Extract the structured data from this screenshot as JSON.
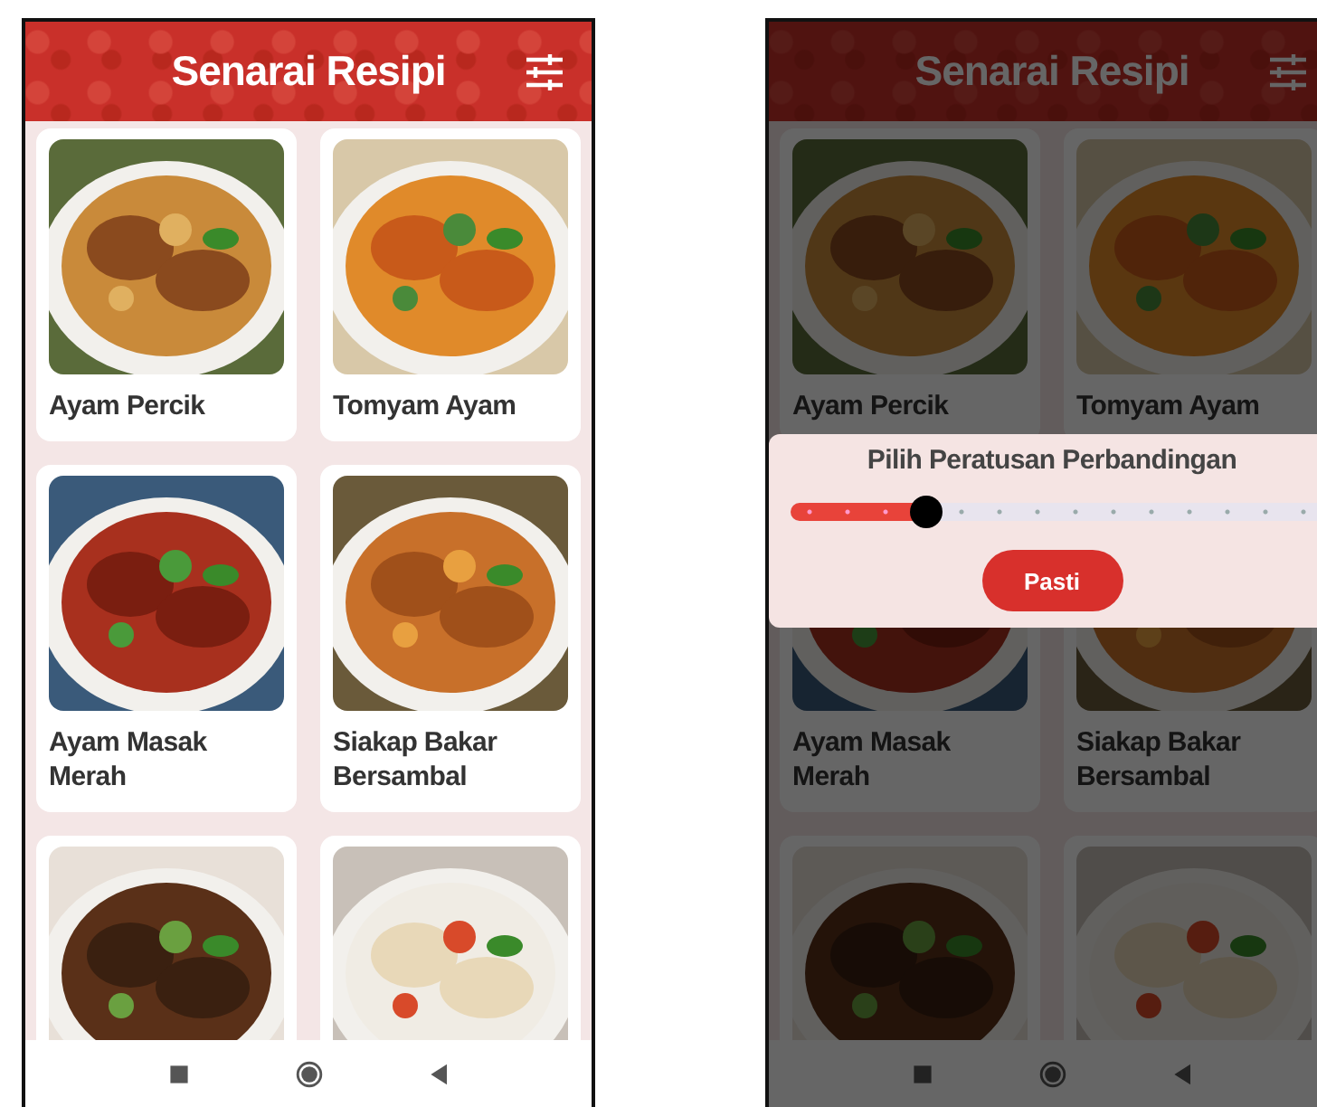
{
  "screens": [
    {
      "title": "Senarai Resipi",
      "recipes": [
        {
          "kind": "titled",
          "title": "Ayam Percik"
        },
        {
          "kind": "titled",
          "title": "Tomyam Ayam"
        },
        {
          "kind": "titled",
          "title": "Ayam Masak Merah"
        },
        {
          "kind": "titled",
          "title": "Siakap Bakar Bersambal"
        },
        {
          "kind": "picture"
        },
        {
          "kind": "picture"
        }
      ]
    },
    {
      "title": "Senarai Resipi",
      "recipes": [
        {
          "kind": "titled",
          "title": "Ayam Percik"
        },
        {
          "kind": "titled",
          "title": "Tomyam Ayam"
        },
        {
          "kind": "titled",
          "title": "Ayam Masak Merah"
        },
        {
          "kind": "titled",
          "title": "Siakap Bakar Bersambal"
        },
        {
          "kind": "picture"
        },
        {
          "kind": "picture"
        }
      ],
      "dialog": {
        "title": "Pilih Peratusan Perbandingan",
        "level": 0.25,
        "button": "Pasti"
      }
    }
  ]
}
